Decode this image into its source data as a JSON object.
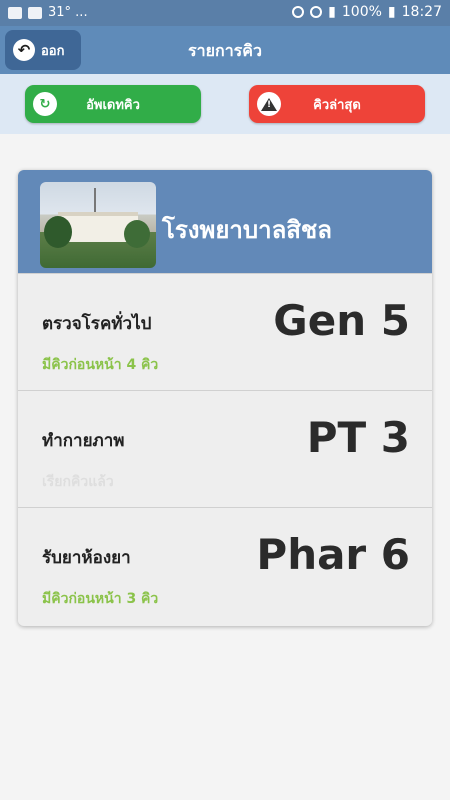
{
  "status_bar": {
    "left_text": "31° ...",
    "battery": "100%",
    "time": "18:27"
  },
  "header": {
    "back_label": "ออก",
    "title": "รายการคิว"
  },
  "actions": {
    "update_label": "อัพเดทคิว",
    "latest_label": "คิวล่าสุด"
  },
  "hospital": {
    "name": "โรงพยาบาลสิชล"
  },
  "queues": [
    {
      "service": "ตรวจโรคทั่วไป",
      "number": "Gen 5",
      "note": "มีคิวก่อนหน้า 4 คิว"
    },
    {
      "service": "ทำกายภาพ",
      "number": "PT 3",
      "note": "เรียกคิวแล้ว"
    },
    {
      "service": "รับยาห้องยา",
      "number": "Phar 6",
      "note": "มีคิวก่อนหน้า 3 คิว"
    }
  ],
  "colors": {
    "app_bar": "#5f8bb9",
    "update_button": "#31ad48",
    "latest_button": "#ee4339",
    "note_green": "#8bc34a"
  }
}
